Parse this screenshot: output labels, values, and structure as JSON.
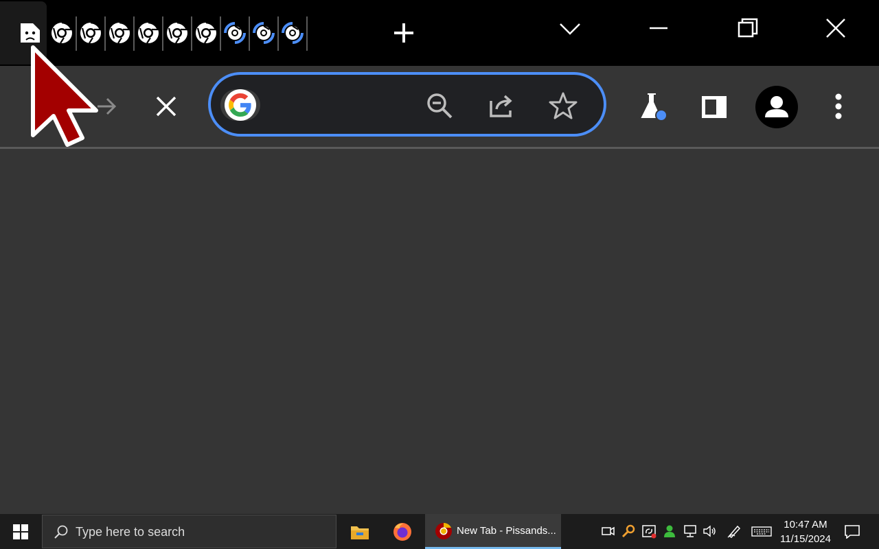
{
  "browser": {
    "tabs": [
      {
        "state": "crashed",
        "icon": "sad-file-icon"
      },
      {
        "state": "loaded",
        "icon": "chrome-icon"
      },
      {
        "state": "loaded",
        "icon": "chrome-icon"
      },
      {
        "state": "loaded",
        "icon": "chrome-icon"
      },
      {
        "state": "loaded",
        "icon": "chrome-icon"
      },
      {
        "state": "loaded",
        "icon": "chrome-icon"
      },
      {
        "state": "loaded",
        "icon": "chrome-icon"
      },
      {
        "state": "loading",
        "icon": "chrome-icon"
      },
      {
        "state": "loading",
        "icon": "chrome-icon"
      },
      {
        "state": "loading",
        "icon": "chrome-icon"
      }
    ],
    "new_tab_icon": "plus-icon",
    "tab_search_icon": "chevron-down-icon",
    "window_controls": [
      "minimize-icon",
      "restore-icon",
      "close-icon"
    ],
    "toolbar": {
      "back_icon": "arrow-left-icon",
      "forward_icon": "arrow-right-icon",
      "stop_icon": "close-icon",
      "extensions": [
        "labs-flask-icon",
        "side-panel-icon",
        "profile-avatar-icon",
        "more-vert-icon"
      ]
    },
    "omnibox": {
      "value": "",
      "site_icon": "google-g-icon",
      "actions": [
        "zoom-out-icon",
        "share-icon",
        "bookmark-star-icon"
      ]
    }
  },
  "taskbar": {
    "search_placeholder": "Type here to search",
    "pinned": [
      "file-explorer-icon",
      "firefox-icon"
    ],
    "active_window_label": "New Tab - Pissands...",
    "tray_icons": [
      "meet-now-icon",
      "search-key-icon",
      "sync-icon",
      "user-icon",
      "network-icon",
      "volume-icon",
      "pen-icon",
      "keyboard-icon"
    ],
    "time": "10:47 AM",
    "date": "11/15/2024"
  },
  "colors": {
    "accent_blue": "#4c8ef7",
    "taskbar_active_underline": "#76b9ed",
    "cursor_red": "#a30000"
  }
}
